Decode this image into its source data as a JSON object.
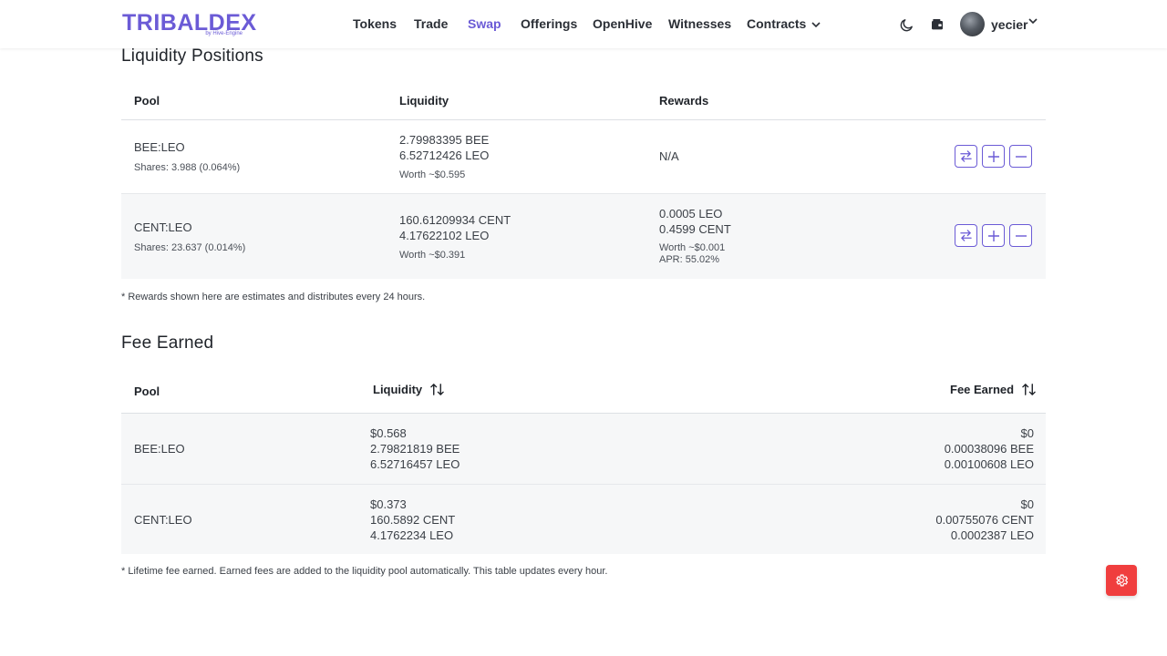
{
  "brand": {
    "name": "TRIBALDEX",
    "tagline": "by Hive-Engine",
    "color": "#6b5bd6"
  },
  "nav": {
    "items": [
      "Tokens",
      "Trade",
      "Swap",
      "Offerings",
      "OpenHive",
      "Witnesses",
      "Contracts"
    ],
    "active": "Swap",
    "user": "yecier",
    "icons": [
      "moon-icon",
      "wallet-icon",
      "chevron-down-icon"
    ]
  },
  "liquidity": {
    "title": "Liquidity Positions",
    "headers": {
      "pool": "Pool",
      "liquidity": "Liquidity",
      "rewards": "Rewards"
    },
    "rows": [
      {
        "pool": "BEE:LEO",
        "shares": "Shares: 3.988 (0.064%)",
        "liq1": "2.79983395 BEE",
        "liq2": "6.52712426 LEO",
        "worth": "Worth ~$0.595",
        "rewards1": "N/A"
      },
      {
        "pool": "CENT:LEO",
        "shares": "Shares: 23.637 (0.014%)",
        "liq1": "160.61209934 CENT",
        "liq2": "4.17622102 LEO",
        "worth": "Worth ~$0.391",
        "rewards1": "0.0005 LEO",
        "rewards2": "0.4599 CENT",
        "rewards_worth": "Worth ~$0.001",
        "apr": "APR: 55.02%"
      }
    ],
    "note": "* Rewards shown here are estimates and distributes every 24 hours."
  },
  "fees": {
    "title": "Fee Earned",
    "headers": {
      "pool": "Pool",
      "liquidity": "Liquidity",
      "fee": "Fee Earned"
    },
    "rows": [
      {
        "pool": "BEE:LEO",
        "liq_usd": "$0.568",
        "liq1": "2.79821819 BEE",
        "liq2": "6.52716457 LEO",
        "fee_usd": "$0",
        "fee1": "0.00038096 BEE",
        "fee2": "0.00100608 LEO"
      },
      {
        "pool": "CENT:LEO",
        "liq_usd": "$0.373",
        "liq1": "160.5892 CENT",
        "liq2": "4.1762234 LEO",
        "fee_usd": "$0",
        "fee1": "0.00755076 CENT",
        "fee2": "0.0002387 LEO"
      }
    ],
    "note": "* Lifetime fee earned. Earned fees are added to the liquidity pool automatically. This table updates every hour."
  },
  "colors": {
    "accent": "#6b5bd6",
    "danger": "#f03e3e",
    "row_alt": "#f6f7f8"
  }
}
